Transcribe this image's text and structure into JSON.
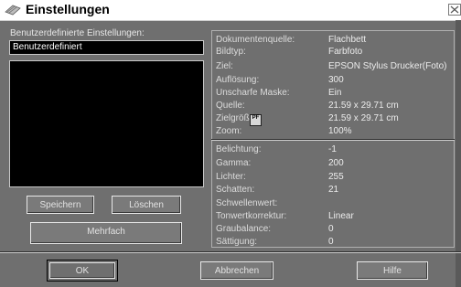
{
  "window": {
    "title": "Einstellungen"
  },
  "presets": {
    "label": "Benutzerdefinierte Einstellungen:",
    "current_name": "Benutzerdefiniert",
    "save_label": "Speichern",
    "delete_label": "Löschen",
    "multi_label": "Mehrfach"
  },
  "info": {
    "source": {
      "label": "Dokumentenquelle:",
      "value": "Flachbett"
    },
    "image_type": {
      "label": "Bildtyp:",
      "value": "Farbfoto"
    },
    "target": {
      "label": "Ziel:",
      "value": "EPSON Stylus Drucker(Foto)"
    },
    "resolution": {
      "label": "Auflösung:",
      "value": "300"
    },
    "unsharp_mask": {
      "label": "Unscharfe Maske:",
      "value": "Ein"
    },
    "source_size": {
      "label": "Quelle:",
      "value": "21.59 x 29.71 cm"
    },
    "target_size": {
      "label": "Zielgröße:",
      "value": "21.59 x 29.71 cm"
    },
    "zoom": {
      "label": "Zoom:",
      "value": "100%"
    },
    "exposure": {
      "label": "Belichtung:",
      "value": "-1"
    },
    "gamma": {
      "label": "Gamma:",
      "value": "200"
    },
    "highlights": {
      "label": "Lichter:",
      "value": "255"
    },
    "shadows": {
      "label": "Schatten:",
      "value": "21"
    },
    "threshold": {
      "label": "Schwellenwert:",
      "value": ""
    },
    "tone_correction": {
      "label": "Tonwertkorrektur:",
      "value": "Linear"
    },
    "gray_balance": {
      "label": "Graubalance:",
      "value": "0"
    },
    "saturation": {
      "label": "Sättigung:",
      "value": "0"
    },
    "target_size_icon_text": "PF"
  },
  "footer": {
    "ok_label": "OK",
    "cancel_label": "Abbrechen",
    "help_label": "Hilfe"
  }
}
